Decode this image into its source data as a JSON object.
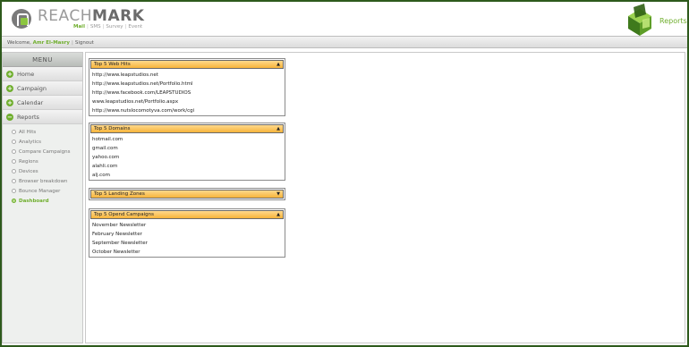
{
  "brand": {
    "name_part1": "REACH",
    "name_part2": "MARK",
    "products": [
      "Mail",
      "SMS",
      "Survey",
      "Event"
    ],
    "accent_color": "#6fae2d"
  },
  "header": {
    "section_label": "Reports",
    "section_icon": "reports-cube-icon"
  },
  "welcome_bar": {
    "greeting": "Welcome,",
    "user_name": "Amr El-Masry",
    "signout_label": "Signout"
  },
  "sidebar": {
    "title": "MENU",
    "items": [
      {
        "label": "Home",
        "icon": "plus-icon"
      },
      {
        "label": "Campaign",
        "icon": "plus-icon"
      },
      {
        "label": "Calendar",
        "icon": "plus-icon"
      },
      {
        "label": "Reports",
        "icon": "minus-icon"
      }
    ],
    "reports_subitems": [
      "All Hits",
      "Analytics",
      "Compare Campaigns",
      "Regions",
      "Devices",
      "Browser breakdown",
      "Bounce Manager",
      "Dashboard"
    ],
    "active_subitem": "Dashboard"
  },
  "widgets": {
    "web_hits": {
      "title": "Top 5 Web Hits",
      "rows": [
        "http://www.leapstudios.net",
        "http://www.leapstudios.net/Portfolio.html",
        "http://www.facebook.com/LEAPSTUDIOS",
        "www.leapstudios.net/Portfolio.aspx",
        "http://www.nutslocomotyva.com/work/cgi"
      ]
    },
    "domains": {
      "title": "Top 5 Domains",
      "rows": [
        "hotmail.com",
        "gmail.com",
        "yahoo.com",
        "alahli.com",
        "alj.com"
      ]
    },
    "landing_zones": {
      "title": "Top 5 Landing Zones",
      "rows": []
    },
    "opened_campaigns": {
      "title": "Top 5 Opend Campaigns",
      "rows": [
        "November Newsletter",
        "February Newsletter",
        "September Newsletter",
        "October Newsletter"
      ]
    }
  }
}
